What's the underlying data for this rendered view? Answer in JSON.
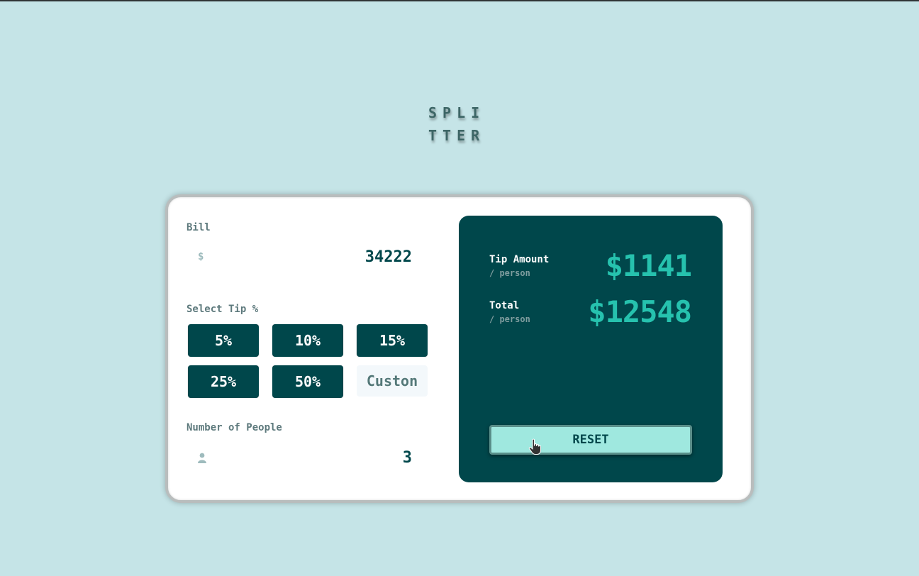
{
  "app": {
    "logo_line1": "SPLI",
    "logo_line2": "TTER"
  },
  "bill": {
    "label": "Bill",
    "currency_icon": "dollar-icon",
    "currency_symbol": "$",
    "value": "34222"
  },
  "tip": {
    "label": "Select Tip %",
    "options": [
      "5%",
      "10%",
      "15%",
      "25%",
      "50%"
    ],
    "custom_value": "Custon"
  },
  "people": {
    "label": "Number of People",
    "icon": "person-icon",
    "value": "3"
  },
  "results": {
    "tip_amount_label": "Tip Amount",
    "tip_amount_sub": "/ person",
    "tip_amount_value": "$1141",
    "total_label": "Total",
    "total_sub": "/ person",
    "total_value": "$12548",
    "reset_label": "RESET"
  },
  "colors": {
    "background": "#c5e4e7",
    "panel": "#00474b",
    "accent": "#26c2ae",
    "reset_button": "#9fe8df"
  }
}
